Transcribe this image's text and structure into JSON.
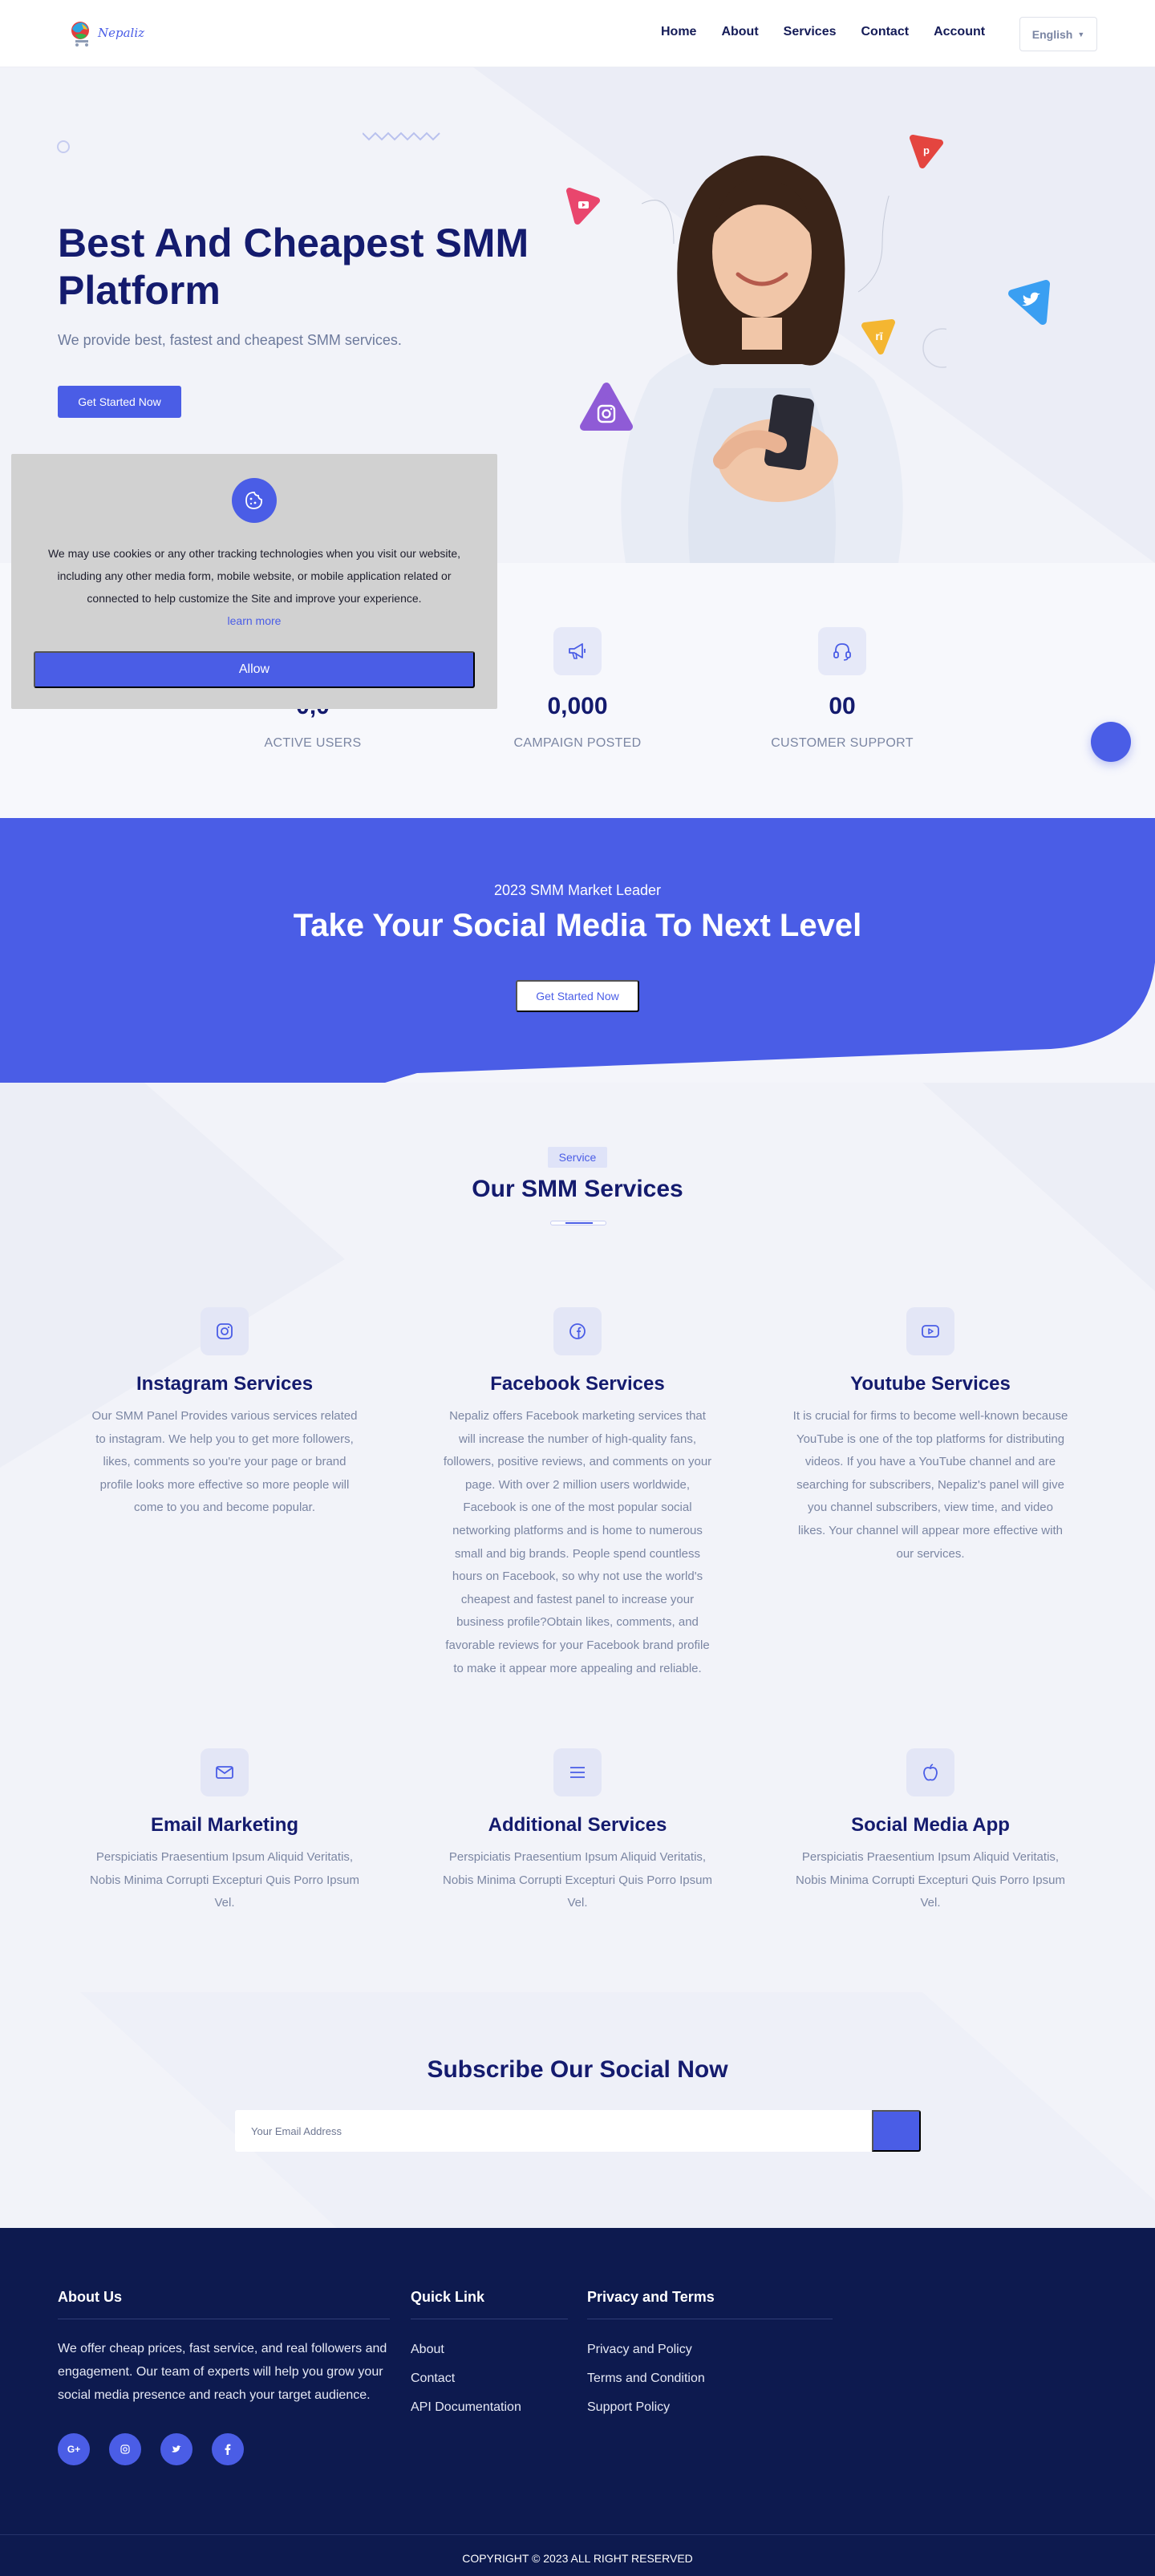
{
  "brand": {
    "name": "Nepaliz"
  },
  "nav": {
    "items": [
      "Home",
      "About",
      "Services",
      "Contact",
      "Account"
    ],
    "language": "English"
  },
  "hero": {
    "title": "Best And Cheapest SMM Platform",
    "subtitle": "We provide best, fastest and cheapest SMM services.",
    "cta": "Get Started Now"
  },
  "stats": [
    {
      "value": "0,0",
      "label": "ACTIVE USERS",
      "icon": "users-icon"
    },
    {
      "value": "0,000",
      "label": "CAMPAIGN POSTED",
      "icon": "megaphone-icon"
    },
    {
      "value": "00",
      "label": "CUSTOMER SUPPORT",
      "icon": "headset-icon"
    }
  ],
  "cookie": {
    "text": "We may use cookies or any other tracking technologies when you visit our website, including any other media form, mobile website, or mobile application related or connected to help customize the Site and improve your experience.",
    "link": "learn more",
    "button": "Allow"
  },
  "cta": {
    "eyebrow": "2023 SMM Market Leader",
    "title": "Take Your Social Media To Next Level",
    "button": "Get Started Now"
  },
  "services": {
    "badge": "Service",
    "title": "Our SMM Services",
    "items": [
      {
        "name": "Instagram Services",
        "icon": "instagram-icon",
        "desc": "Our SMM Panel Provides various services related to instagram. We help you to get more followers, likes, comments so you're your page or brand profile looks more effective so more people will come to you and become popular."
      },
      {
        "name": "Facebook Services",
        "icon": "facebook-icon",
        "desc": "Nepaliz offers Facebook marketing services that will increase the number of high-quality fans, followers, positive reviews, and comments on your page. With over 2 million users worldwide, Facebook is one of the most popular social networking platforms and is home to numerous small and big brands. People spend countless hours on Facebook, so why not use the world's cheapest and fastest panel to increase your business profile?Obtain likes, comments, and favorable reviews for your Facebook brand profile to make it appear more appealing and reliable."
      },
      {
        "name": "Youtube Services",
        "icon": "youtube-icon",
        "desc": "It is crucial for firms to become well-known because YouTube is one of the top platforms for distributing videos. If you have a YouTube channel and are searching for subscribers, Nepaliz's panel will give you channel subscribers, view time, and video likes. Your channel will appear more effective with our services."
      },
      {
        "name": "Email Marketing",
        "icon": "email-icon",
        "desc": "Perspiciatis Praesentium Ipsum Aliquid Veritatis, Nobis Minima Corrupti Excepturi Quis Porro Ipsum Vel."
      },
      {
        "name": "Additional Services",
        "icon": "menu-lines-icon",
        "desc": "Perspiciatis Praesentium Ipsum Aliquid Veritatis, Nobis Minima Corrupti Excepturi Quis Porro Ipsum Vel."
      },
      {
        "name": "Social Media App",
        "icon": "apple-icon",
        "desc": "Perspiciatis Praesentium Ipsum Aliquid Veritatis, Nobis Minima Corrupti Excepturi Quis Porro Ipsum Vel."
      }
    ]
  },
  "subscribe": {
    "title": "Subscribe Our Social Now",
    "placeholder": "Your Email Address"
  },
  "footer": {
    "about_title": "About Us",
    "about_text": "We offer cheap prices, fast service, and real followers and engagement. Our team of experts will help you grow your social media presence and reach your target audience.",
    "quick_title": "Quick Link",
    "quick_links": [
      "About",
      "Contact",
      "API Documentation"
    ],
    "terms_title": "Privacy and Terms",
    "terms_links": [
      "Privacy and Policy",
      "Terms and Condition",
      "Support Policy"
    ],
    "social": [
      "G+",
      "instagram-icon",
      "twitter-icon",
      "facebook-icon"
    ],
    "copyright": "COPYRIGHT © 2023 ALL RIGHT RESERVED"
  },
  "colors": {
    "primary": "#4a5de6",
    "heading": "#141b6e",
    "footer_bg": "#0d1a4f"
  }
}
